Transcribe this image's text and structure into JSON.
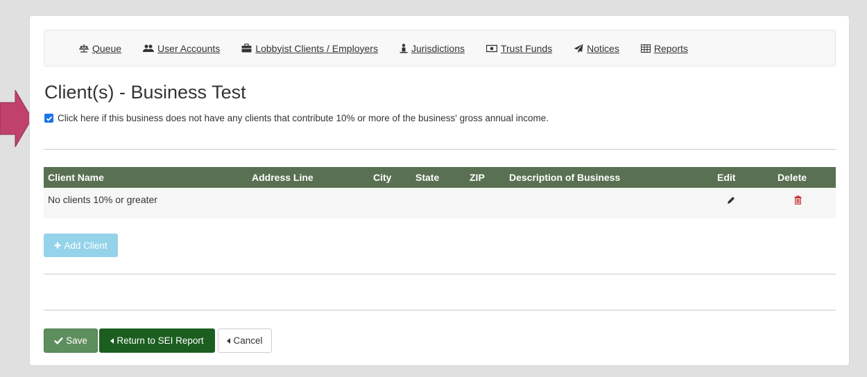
{
  "nav": {
    "items": [
      {
        "label": "Queue",
        "icon": "balance-scale-icon"
      },
      {
        "label": "User Accounts",
        "icon": "users-icon"
      },
      {
        "label": "Lobbyist Clients / Employers",
        "icon": "briefcase-icon"
      },
      {
        "label": "Jurisdictions",
        "icon": "person-icon"
      },
      {
        "label": "Trust Funds",
        "icon": "money-icon"
      },
      {
        "label": "Notices",
        "icon": "send-icon"
      },
      {
        "label": "Reports",
        "icon": "table-icon"
      }
    ]
  },
  "page": {
    "title": "Client(s) - Business Test",
    "checkbox_label": "Click here if this business does not have any clients that contribute 10% or more of the business' gross annual income.",
    "checkbox_checked": true
  },
  "table": {
    "headers": {
      "client_name": "Client Name",
      "address_line": "Address Line",
      "city": "City",
      "state": "State",
      "zip": "ZIP",
      "description": "Description of Business",
      "edit": "Edit",
      "delete": "Delete"
    },
    "rows": [
      {
        "client_name": "No clients 10% or greater",
        "address_line": "",
        "city": "",
        "state": "",
        "zip": "",
        "description": ""
      }
    ]
  },
  "buttons": {
    "add_client": "Add Client",
    "save": "Save",
    "return": "Return to SEI Report",
    "cancel": "Cancel"
  },
  "colors": {
    "table_header": "#5a7052",
    "arrow": "#c0426c",
    "save": "#5d8e5d",
    "return": "#1b5e20",
    "add_client": "#94d3e9",
    "delete_icon": "#c62828"
  }
}
